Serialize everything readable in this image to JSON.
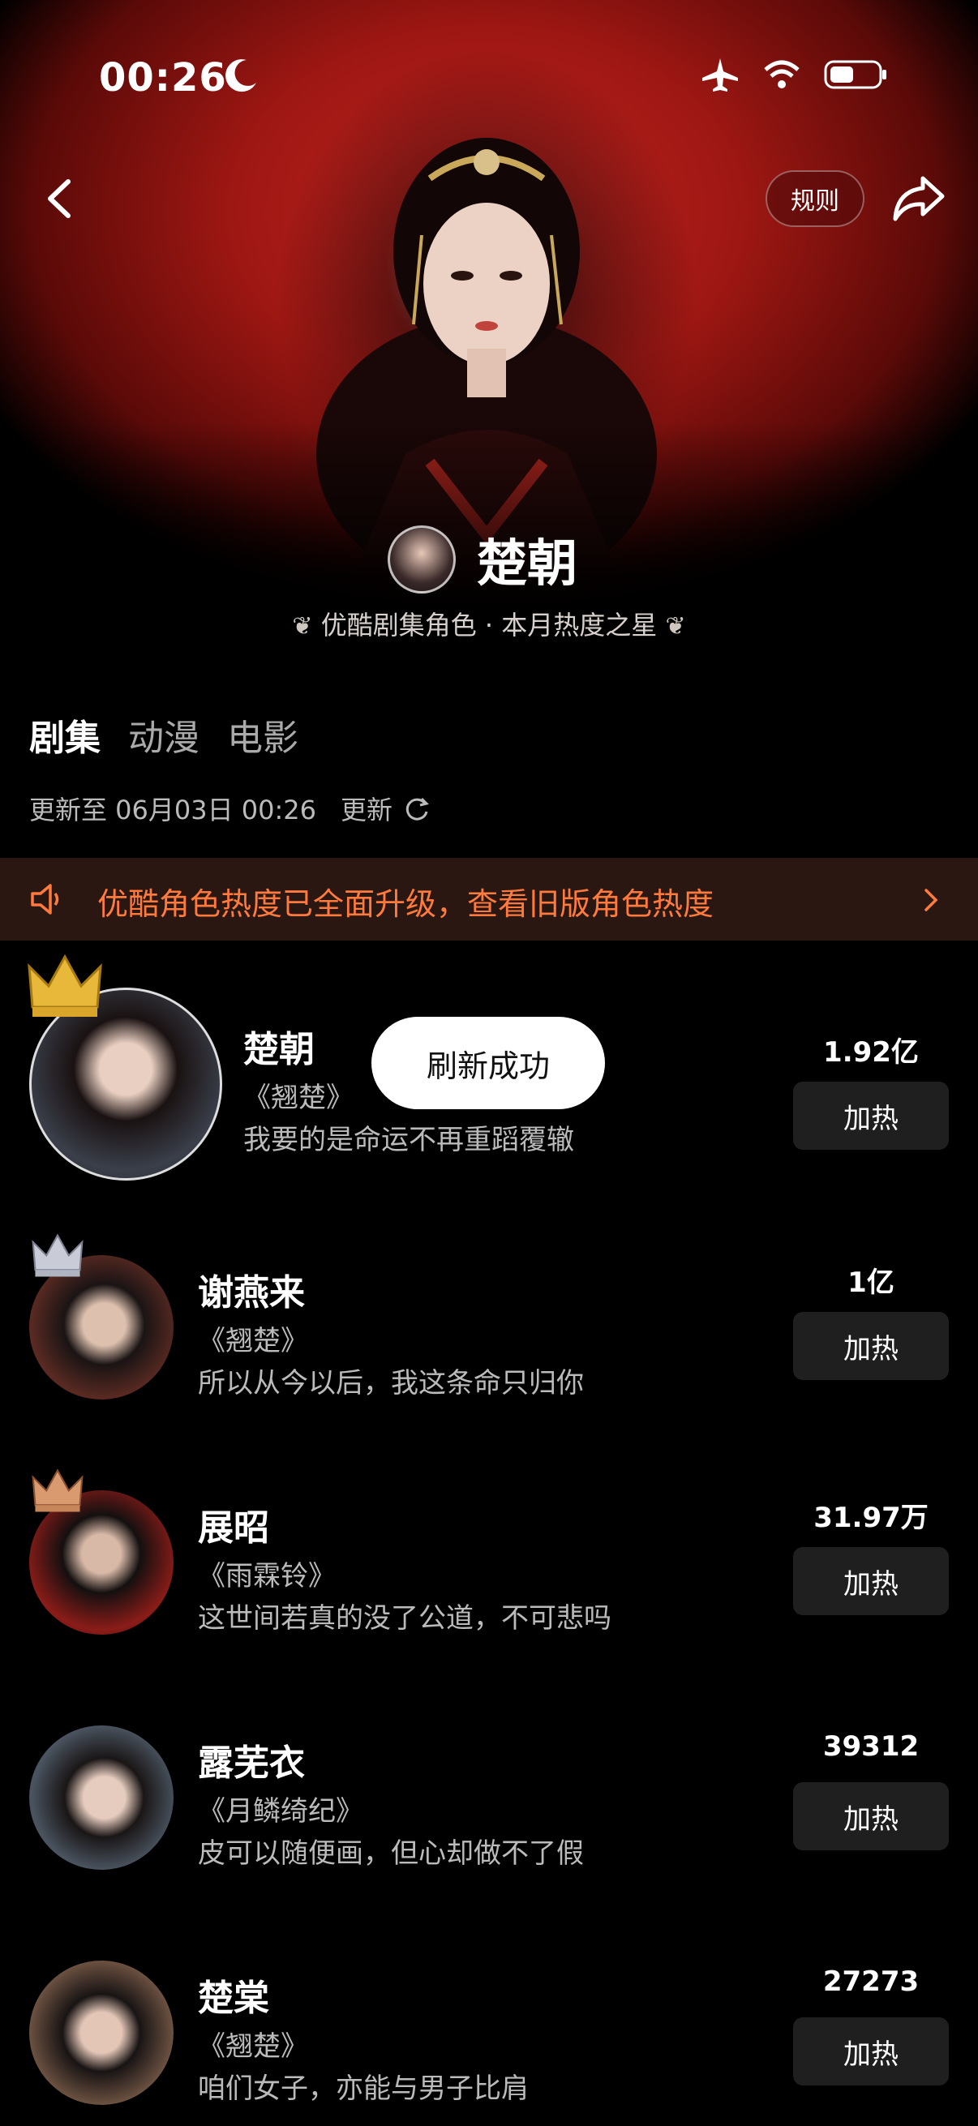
{
  "status_bar": {
    "time": "00:26"
  },
  "header": {
    "rules_label": "规则"
  },
  "hero": {
    "name": "楚朝",
    "subtitle": "优酷剧集角色 · 本月热度之星"
  },
  "tabs": [
    {
      "label": "剧集",
      "active": true
    },
    {
      "label": "动漫",
      "active": false
    },
    {
      "label": "电影",
      "active": false
    }
  ],
  "update": {
    "text": "更新至 06月03日 00:26",
    "refresh_label": "更新"
  },
  "banner": {
    "text": "优酷角色热度已全面升级，查看旧版角色热度"
  },
  "toast": {
    "text": "刷新成功"
  },
  "ranking": [
    {
      "name": "楚朝",
      "show": "《翘楚》",
      "quote": "我要的是命运不再重蹈覆辙",
      "heat": "1.92亿",
      "boost_label": "加热",
      "crown": "gold"
    },
    {
      "name": "谢燕来",
      "show": "《翘楚》",
      "quote": "所以从今以后，我这条命只归你",
      "heat": "1亿",
      "boost_label": "加热",
      "crown": "silver"
    },
    {
      "name": "展昭",
      "show": "《雨霖铃》",
      "quote": "这世间若真的没了公道，不可悲吗",
      "heat": "31.97万",
      "boost_label": "加热",
      "crown": "bronze"
    },
    {
      "name": "露芜衣",
      "show": "《月鳞绮纪》",
      "quote": "皮可以随便画，但心却做不了假",
      "heat": "39312",
      "boost_label": "加热",
      "crown": ""
    },
    {
      "name": "楚棠",
      "show": "《翘楚》",
      "quote": "咱们女子，亦能与男子比肩",
      "heat": "27273",
      "boost_label": "加热",
      "crown": ""
    }
  ],
  "colors": {
    "accent_orange": "#ff7a3d",
    "banner_bg": "#2b1712",
    "hero_red": "#b01d18"
  }
}
